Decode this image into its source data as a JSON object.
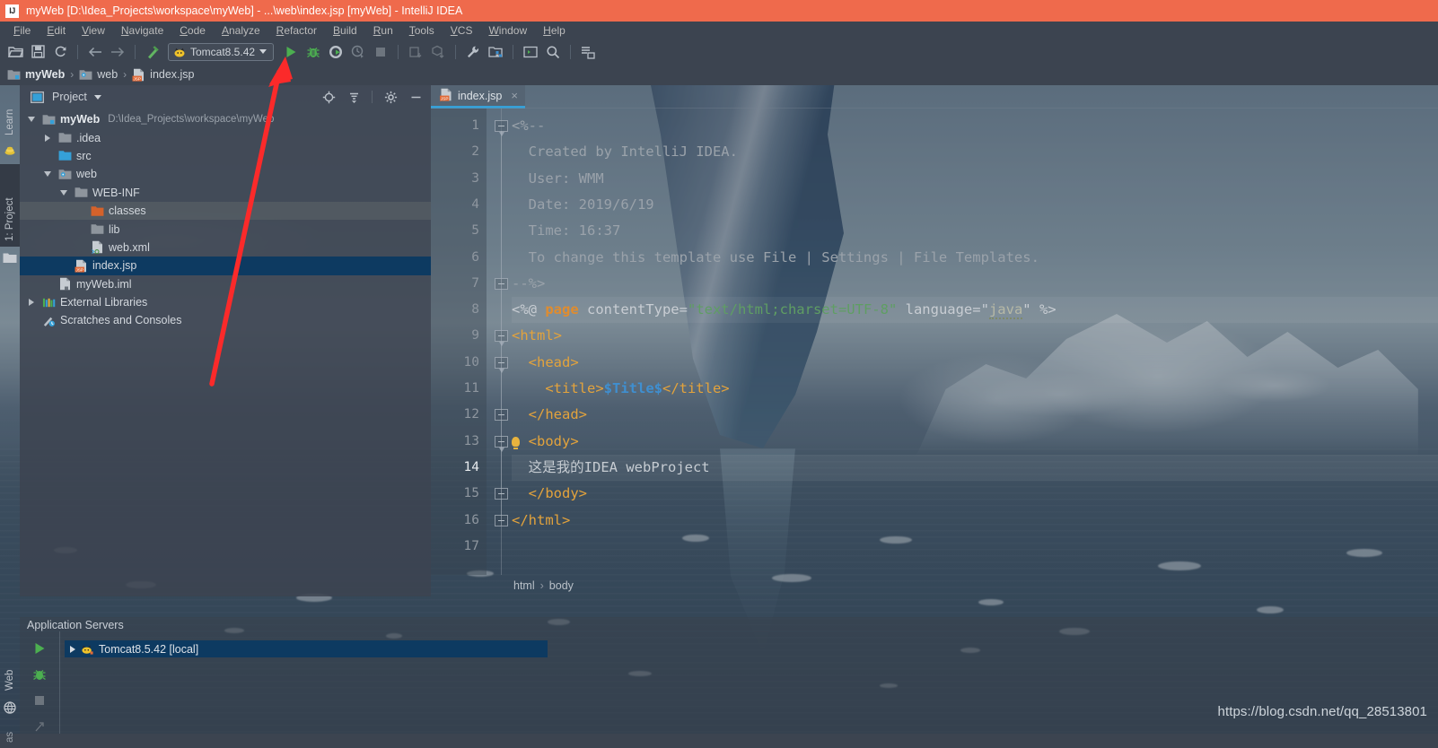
{
  "window": {
    "title": "myWeb [D:\\Idea_Projects\\workspace\\myWeb] - ...\\web\\index.jsp [myWeb] - IntelliJ IDEA",
    "logo_text": "IJ",
    "titlebar_color": "#ef6a4c"
  },
  "menubar": {
    "items": [
      {
        "label": "File"
      },
      {
        "label": "Edit"
      },
      {
        "label": "View"
      },
      {
        "label": "Navigate"
      },
      {
        "label": "Code"
      },
      {
        "label": "Analyze"
      },
      {
        "label": "Refactor"
      },
      {
        "label": "Build"
      },
      {
        "label": "Run"
      },
      {
        "label": "Tools"
      },
      {
        "label": "VCS"
      },
      {
        "label": "Window"
      },
      {
        "label": "Help"
      }
    ]
  },
  "toolbar": {
    "icons": [
      {
        "name": "open-folder-icon"
      },
      {
        "name": "save-all-icon"
      },
      {
        "name": "sync-refresh-icon"
      },
      {
        "name": "back-arrow-icon"
      },
      {
        "name": "forward-arrow-icon"
      },
      {
        "name": "build-hammer-icon"
      }
    ],
    "run_config": {
      "label": "Tomcat8.5.42",
      "icon": "tomcat-cat-icon"
    },
    "run_icons": [
      {
        "name": "run-icon"
      },
      {
        "name": "debug-icon"
      },
      {
        "name": "run-coverage-icon"
      },
      {
        "name": "profile-icon"
      },
      {
        "name": "stop-icon"
      }
    ],
    "right_icons": [
      {
        "name": "update-project-icon"
      },
      {
        "name": "commit-icon"
      },
      {
        "name": "settings-wrench-icon"
      },
      {
        "name": "project-structure-icon"
      },
      {
        "name": "terminal-icon"
      },
      {
        "name": "search-everywhere-icon"
      },
      {
        "name": "database-icon"
      }
    ]
  },
  "navbar": {
    "crumbs": [
      {
        "label": "myWeb",
        "icon": "module-icon",
        "bold": true
      },
      {
        "label": "web",
        "icon": "web-folder-icon",
        "bold": false
      },
      {
        "label": "index.jsp",
        "icon": "jsp-file-icon",
        "bold": false
      }
    ],
    "separator": "›"
  },
  "left_tabs": [
    {
      "label": "Learn",
      "icon": "learn-icon",
      "selected": false
    },
    {
      "label": "1: Project",
      "icon": "project-folder-icon",
      "selected": true
    }
  ],
  "bottom_left_tabs": [
    {
      "label": "Web",
      "icon": "globe-icon"
    }
  ],
  "project_panel": {
    "title": "Project",
    "header_icons": [
      {
        "name": "locate-target-icon"
      },
      {
        "name": "collapse-all-icon"
      },
      {
        "name": "gear-icon"
      },
      {
        "name": "hide-minimize-icon"
      }
    ],
    "tree": [
      {
        "label": "myWeb",
        "path": "D:\\Idea_Projects\\workspace\\myWeb",
        "depth": 0,
        "twisty": "down",
        "icon": "module-icon",
        "bold": true,
        "state": "none"
      },
      {
        "label": ".idea",
        "path": "",
        "depth": 1,
        "twisty": "right",
        "icon": "folder-icon",
        "bold": false,
        "state": "none"
      },
      {
        "label": "src",
        "path": "",
        "depth": 1,
        "twisty": "none",
        "icon": "source-folder-icon",
        "bold": false,
        "state": "none"
      },
      {
        "label": "web",
        "path": "",
        "depth": 1,
        "twisty": "down",
        "icon": "web-folder-icon",
        "bold": false,
        "state": "none"
      },
      {
        "label": "WEB-INF",
        "path": "",
        "depth": 2,
        "twisty": "down",
        "icon": "folder-icon",
        "bold": false,
        "state": "none"
      },
      {
        "label": "classes",
        "path": "",
        "depth": 3,
        "twisty": "none",
        "icon": "output-folder-icon",
        "bold": false,
        "state": "highlight"
      },
      {
        "label": "lib",
        "path": "",
        "depth": 3,
        "twisty": "none",
        "icon": "folder-icon",
        "bold": false,
        "state": "none"
      },
      {
        "label": "web.xml",
        "path": "",
        "depth": 3,
        "twisty": "none",
        "icon": "xml-file-icon",
        "bold": false,
        "state": "none"
      },
      {
        "label": "index.jsp",
        "path": "",
        "depth": 2,
        "twisty": "none",
        "icon": "jsp-file-icon",
        "bold": false,
        "state": "selected"
      },
      {
        "label": "myWeb.iml",
        "path": "",
        "depth": 1,
        "twisty": "none",
        "icon": "iml-file-icon",
        "bold": false,
        "state": "none"
      },
      {
        "label": "External Libraries",
        "path": "",
        "depth": 0,
        "twisty": "right",
        "icon": "libraries-icon",
        "bold": false,
        "state": "none"
      },
      {
        "label": "Scratches and Consoles",
        "path": "",
        "depth": 0,
        "twisty": "none",
        "icon": "scratches-icon",
        "bold": false,
        "state": "none"
      }
    ]
  },
  "editor": {
    "tab": {
      "label": "index.jsp",
      "icon": "jsp-file-icon",
      "close": "×"
    },
    "breadcrumb": {
      "items": [
        "html",
        "body"
      ],
      "separator": "›"
    },
    "line_numbers": [
      "1",
      "2",
      "3",
      "4",
      "5",
      "6",
      "7",
      "8",
      "9",
      "10",
      "11",
      "12",
      "13",
      "14",
      "15",
      "16",
      "17"
    ],
    "current_line": 14,
    "lines": [
      {
        "n": 1,
        "tokens": [
          {
            "t": "<%--",
            "c": "comment"
          }
        ],
        "hl": false
      },
      {
        "n": 2,
        "tokens": [
          {
            "t": "  Created by IntelliJ IDEA.",
            "c": "comment"
          }
        ],
        "hl": false
      },
      {
        "n": 3,
        "tokens": [
          {
            "t": "  User: WMM",
            "c": "comment"
          }
        ],
        "hl": false
      },
      {
        "n": 4,
        "tokens": [
          {
            "t": "  Date: 2019/6/19",
            "c": "comment"
          }
        ],
        "hl": false
      },
      {
        "n": 5,
        "tokens": [
          {
            "t": "  Time: 16:37",
            "c": "comment"
          }
        ],
        "hl": false
      },
      {
        "n": 6,
        "tokens": [
          {
            "t": "  To change this template use File | Settings | File Templates.",
            "c": "comment"
          }
        ],
        "hl": false
      },
      {
        "n": 7,
        "tokens": [
          {
            "t": "--%>",
            "c": "comment"
          }
        ],
        "hl": false
      },
      {
        "n": 8,
        "tokens": [
          {
            "t": "<%@ ",
            "c": "dir"
          },
          {
            "t": "page",
            "c": "kw"
          },
          {
            "t": " contentType=",
            "c": "attr"
          },
          {
            "t": "\"text/html;charset=UTF-8\"",
            "c": "str"
          },
          {
            "t": " language=",
            "c": "attr"
          },
          {
            "t": "\"",
            "c": "attr"
          },
          {
            "t": "java",
            "c": "warn"
          },
          {
            "t": "\" %>",
            "c": "attr"
          }
        ],
        "hl": true
      },
      {
        "n": 9,
        "tokens": [
          {
            "t": "<html>",
            "c": "tag"
          }
        ],
        "hl": false
      },
      {
        "n": 10,
        "tokens": [
          {
            "t": "  <head>",
            "c": "tag"
          }
        ],
        "hl": false
      },
      {
        "n": 11,
        "tokens": [
          {
            "t": "    <title>",
            "c": "tag"
          },
          {
            "t": "$Title$",
            "c": "var"
          },
          {
            "t": "</title>",
            "c": "tag"
          }
        ],
        "hl": false
      },
      {
        "n": 12,
        "tokens": [
          {
            "t": "  </head>",
            "c": "tag"
          }
        ],
        "hl": false
      },
      {
        "n": 13,
        "tokens": [
          {
            "t": "  <body>",
            "c": "tag"
          }
        ],
        "hl": false
      },
      {
        "n": 14,
        "tokens": [
          {
            "t": "  这是我的IDEA webProject",
            "c": "plain"
          }
        ],
        "hl": true
      },
      {
        "n": 15,
        "tokens": [
          {
            "t": "  </body>",
            "c": "tag"
          }
        ],
        "hl": false
      },
      {
        "n": 16,
        "tokens": [
          {
            "t": "</html>",
            "c": "tag"
          }
        ],
        "hl": false
      },
      {
        "n": 17,
        "tokens": [
          {
            "t": "",
            "c": "plain"
          }
        ],
        "hl": false
      }
    ],
    "folds": [
      {
        "line": 1,
        "triangle": true
      },
      {
        "line": 7,
        "triangle": false
      },
      {
        "line": 9,
        "triangle": true
      },
      {
        "line": 10,
        "triangle": true
      },
      {
        "line": 12,
        "triangle": false
      },
      {
        "line": 13,
        "triangle": true
      },
      {
        "line": 15,
        "triangle": false
      },
      {
        "line": 16,
        "triangle": false
      }
    ],
    "bulb_line": 13
  },
  "bottom_panel": {
    "title": "Application Servers",
    "buttons": [
      {
        "name": "rerun-icon"
      },
      {
        "name": "debug-icon"
      },
      {
        "name": "stop-icon"
      },
      {
        "name": "settings-icon"
      }
    ],
    "server": {
      "label": "Tomcat8.5.42 [local]",
      "icon": "tomcat-cat-icon"
    }
  },
  "annotation": {
    "type": "red-arrow",
    "color": "#fb2a2a"
  },
  "watermark": {
    "text": "https://blog.csdn.net/qq_28513801"
  }
}
